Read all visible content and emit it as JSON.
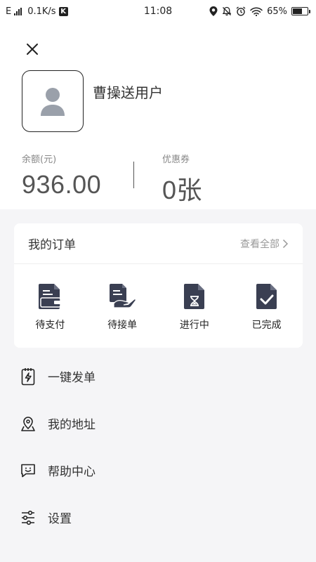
{
  "status_bar": {
    "network_type": "E",
    "speed": "0.1K/s",
    "k_badge": "K",
    "time": "11:08",
    "battery": "65%",
    "battery_level": 0.65
  },
  "profile": {
    "username": "曹操送用户",
    "balance_label": "余额(元)",
    "balance_value": "936.00",
    "coupon_label": "优惠券",
    "coupon_value": "0张"
  },
  "orders": {
    "title": "我的订单",
    "view_all": "查看全部",
    "items": [
      {
        "label": "待支付",
        "icon": "wallet-doc-icon"
      },
      {
        "label": "待接单",
        "icon": "hand-doc-icon"
      },
      {
        "label": "进行中",
        "icon": "hourglass-doc-icon"
      },
      {
        "label": "已完成",
        "icon": "check-doc-icon"
      }
    ]
  },
  "menu": [
    {
      "label": "一键发单",
      "icon": "lightning-clipboard-icon"
    },
    {
      "label": "我的地址",
      "icon": "map-pin-icon"
    },
    {
      "label": "帮助中心",
      "icon": "chat-smile-icon"
    },
    {
      "label": "设置",
      "icon": "sliders-icon"
    }
  ],
  "colors": {
    "icon_dark": "#3a3f52",
    "background": "#f5f5f7",
    "card": "#ffffff"
  }
}
